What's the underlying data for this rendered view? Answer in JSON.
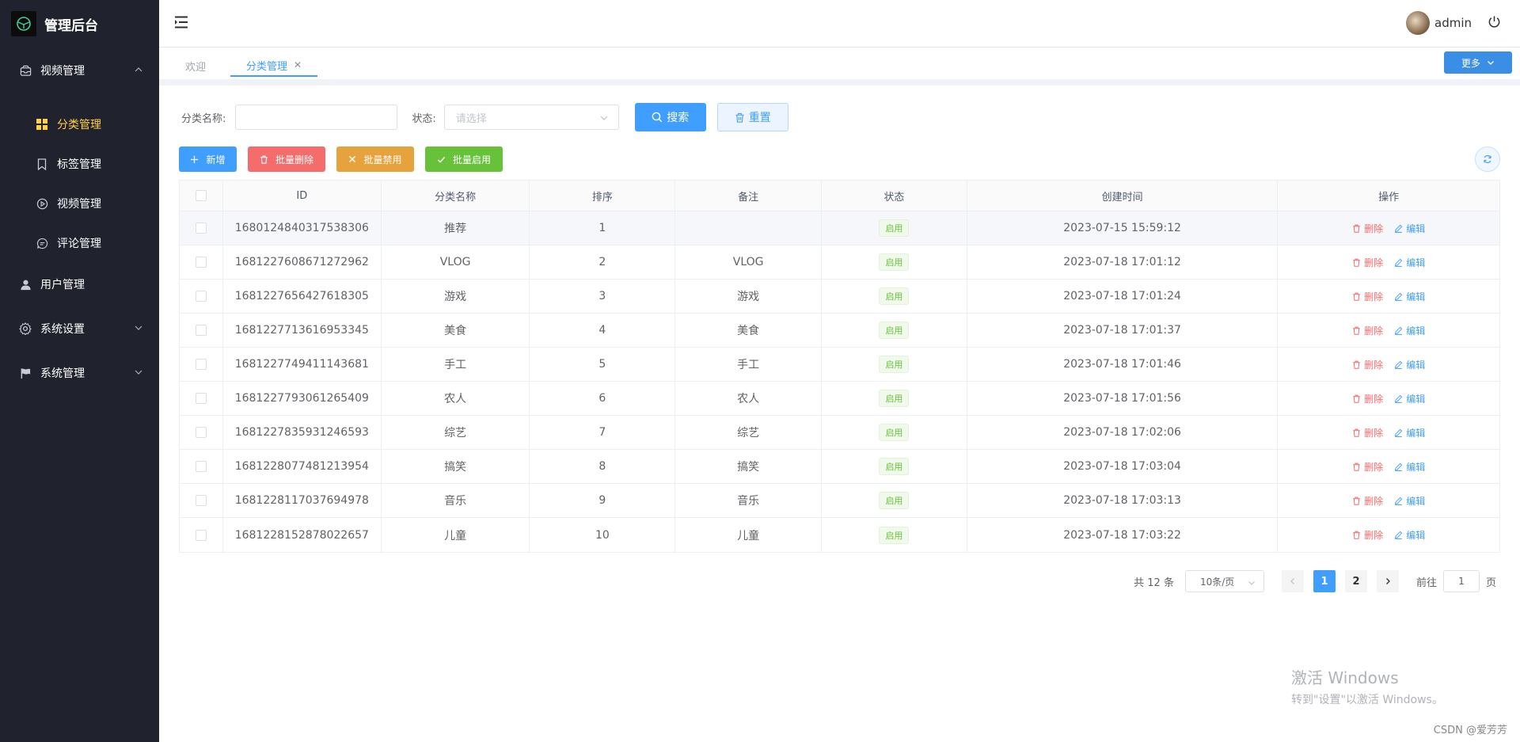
{
  "app": {
    "title": "管理后台"
  },
  "sidebar": {
    "items": [
      {
        "label": "视频管理",
        "icon": "inbox-icon"
      },
      {
        "label": "分类管理",
        "icon": "grid-icon",
        "active": true
      },
      {
        "label": "标签管理",
        "icon": "bookmark-icon"
      },
      {
        "label": "视频管理",
        "icon": "play-circle-icon"
      },
      {
        "label": "评论管理",
        "icon": "chat-icon"
      },
      {
        "label": "用户管理",
        "icon": "user-icon"
      },
      {
        "label": "系统设置",
        "icon": "gear-icon"
      },
      {
        "label": "系统管理",
        "icon": "flag-icon"
      }
    ]
  },
  "header": {
    "username": "admin"
  },
  "tabs": {
    "items": [
      {
        "label": "欢迎"
      },
      {
        "label": "分类管理"
      }
    ],
    "more_label": "更多"
  },
  "filter": {
    "name_label": "分类名称:",
    "status_label": "状态:",
    "status_placeholder": "请选择",
    "search_label": "搜索",
    "reset_label": "重置"
  },
  "actions": {
    "add_label": "新增",
    "batch_delete_label": "批量删除",
    "batch_disable_label": "批量禁用",
    "batch_enable_label": "批量启用"
  },
  "table": {
    "columns": [
      "ID",
      "分类名称",
      "排序",
      "备注",
      "状态",
      "创建时间",
      "操作"
    ],
    "delete_label": "删除",
    "edit_label": "编辑",
    "rows": [
      {
        "id": "1680124840317538306",
        "name": "推荐",
        "sort": "1",
        "note": "",
        "status": "启用",
        "created": "2023-07-15 15:59:12"
      },
      {
        "id": "1681227608671272962",
        "name": "VLOG",
        "sort": "2",
        "note": "VLOG",
        "status": "启用",
        "created": "2023-07-18 17:01:12"
      },
      {
        "id": "1681227656427618305",
        "name": "游戏",
        "sort": "3",
        "note": "游戏",
        "status": "启用",
        "created": "2023-07-18 17:01:24"
      },
      {
        "id": "1681227713616953345",
        "name": "美食",
        "sort": "4",
        "note": "美食",
        "status": "启用",
        "created": "2023-07-18 17:01:37"
      },
      {
        "id": "1681227749411143681",
        "name": "手工",
        "sort": "5",
        "note": "手工",
        "status": "启用",
        "created": "2023-07-18 17:01:46"
      },
      {
        "id": "1681227793061265409",
        "name": "农人",
        "sort": "6",
        "note": "农人",
        "status": "启用",
        "created": "2023-07-18 17:01:56"
      },
      {
        "id": "1681227835931246593",
        "name": "综艺",
        "sort": "7",
        "note": "综艺",
        "status": "启用",
        "created": "2023-07-18 17:02:06"
      },
      {
        "id": "1681228077481213954",
        "name": "搞笑",
        "sort": "8",
        "note": "搞笑",
        "status": "启用",
        "created": "2023-07-18 17:03:04"
      },
      {
        "id": "1681228117037694978",
        "name": "音乐",
        "sort": "9",
        "note": "音乐",
        "status": "启用",
        "created": "2023-07-18 17:03:13"
      },
      {
        "id": "1681228152878022657",
        "name": "儿童",
        "sort": "10",
        "note": "儿童",
        "status": "启用",
        "created": "2023-07-18 17:03:22"
      }
    ]
  },
  "pagination": {
    "total_label": "共 12 条",
    "page_size": "10条/页",
    "pages": [
      "1",
      "2"
    ],
    "current_page": "1",
    "goto_prefix": "前往",
    "goto_value": "1",
    "goto_suffix": "页"
  },
  "watermark": {
    "title": "激活 Windows",
    "subtitle": "转到\"设置\"以激活 Windows。"
  },
  "footer": {
    "credit": "CSDN @爱芳芳"
  },
  "colors": {
    "primary": "#409eff",
    "danger": "#f56c6c",
    "warning": "#e6a23c",
    "success": "#67c23a",
    "sidebar_bg": "#20232e",
    "active_menu": "#ffd04b"
  }
}
